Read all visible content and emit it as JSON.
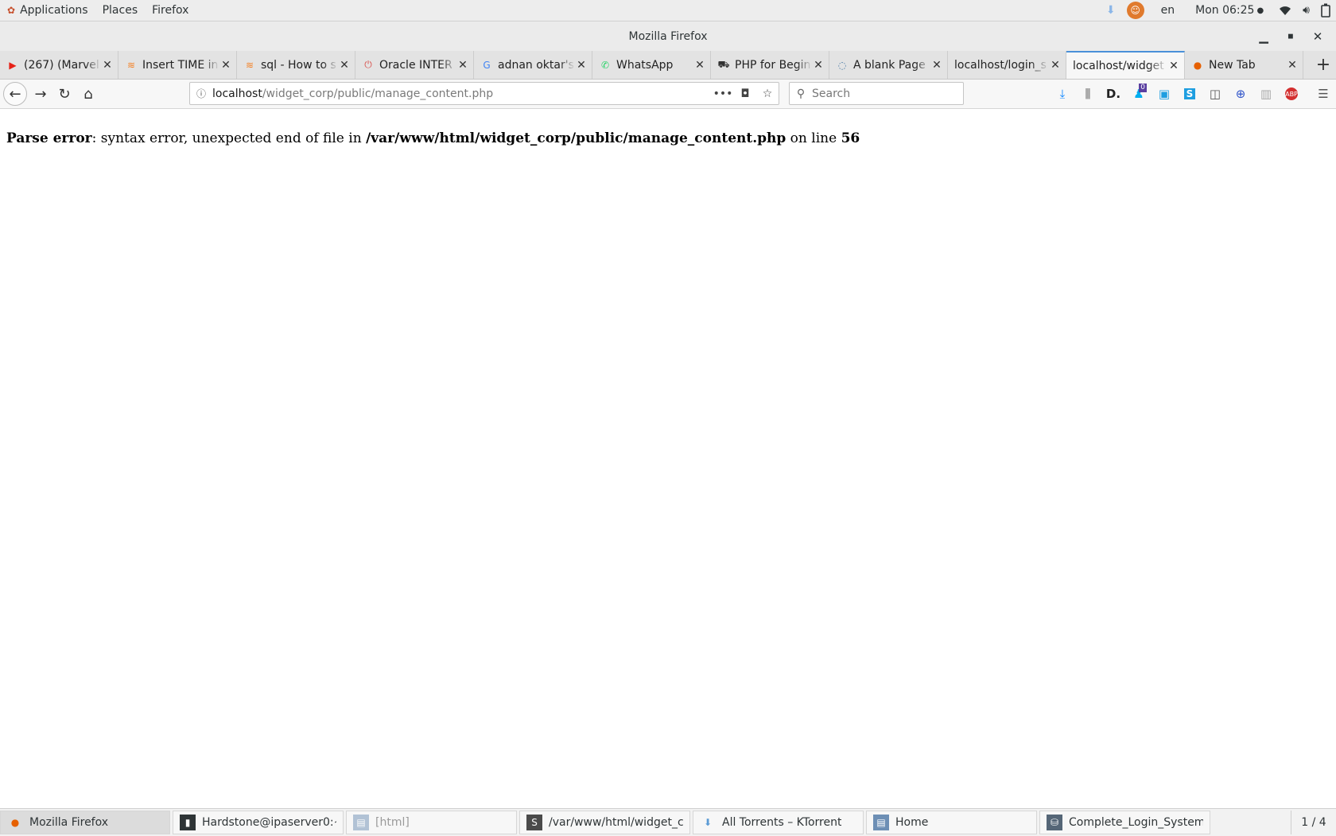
{
  "topbar": {
    "menus": [
      "Applications",
      "Places",
      "Firefox"
    ],
    "language": "en",
    "clock": "Mon 06:25"
  },
  "window": {
    "title": "Mozilla Firefox"
  },
  "tabs": [
    {
      "label": "(267) (Marvel",
      "icon": "youtube-icon",
      "glyph": "▶",
      "color": "#e62117"
    },
    {
      "label": "Insert TIME in",
      "icon": "stackoverflow-icon",
      "glyph": "≋",
      "color": "#f48024"
    },
    {
      "label": "sql - How to s",
      "icon": "stackoverflow-icon",
      "glyph": "≋",
      "color": "#f48024"
    },
    {
      "label": "Oracle INTER",
      "icon": "power-icon",
      "glyph": "⏻",
      "color": "#d9534f"
    },
    {
      "label": "adnan oktar's",
      "icon": "google-icon",
      "glyph": "G",
      "color": "#4285f4"
    },
    {
      "label": "WhatsApp",
      "icon": "whatsapp-icon",
      "glyph": "✆",
      "color": "#25d366"
    },
    {
      "label": "PHP for Begin",
      "icon": "car-icon",
      "glyph": "⛟",
      "color": "#333333"
    },
    {
      "label": "A blank Page",
      "icon": "page-icon",
      "glyph": "◌",
      "color": "#4a7ba6"
    },
    {
      "label": "localhost/login_s",
      "icon": "",
      "glyph": "",
      "color": "#333333"
    },
    {
      "label": "localhost/widget",
      "icon": "",
      "glyph": "",
      "color": "#333333",
      "active": true
    },
    {
      "label": "New Tab",
      "icon": "firefox-icon",
      "glyph": "●",
      "color": "#e66000"
    }
  ],
  "urlbar": {
    "host": "localhost",
    "path": "/widget_corp/public/manage_content.php"
  },
  "search": {
    "placeholder": "Search"
  },
  "page": {
    "error_label": "Parse error",
    "error_text": ": syntax error, unexpected end of file in ",
    "error_file": "/var/www/html/widget_corp/public/manage_content.php",
    "error_on": " on line ",
    "error_line": "56"
  },
  "toolbar_badge": "0",
  "taskbar": {
    "items": [
      {
        "label": "Mozilla Firefox",
        "icon": "firefox-icon",
        "active": true
      },
      {
        "label": "Hardstone@ipaserver0:~",
        "icon": "terminal-icon"
      },
      {
        "label": "[html]",
        "icon": "files-icon",
        "dim": true
      },
      {
        "label": "/var/www/html/widget_corp/p...",
        "icon": "sublime-icon"
      },
      {
        "label": "All Torrents – KTorrent",
        "icon": "ktorrent-icon"
      },
      {
        "label": "Home",
        "icon": "files-icon"
      },
      {
        "label": "Complete_Login_System_In_...",
        "icon": "network-icon"
      }
    ],
    "workspace": "1 / 4"
  }
}
